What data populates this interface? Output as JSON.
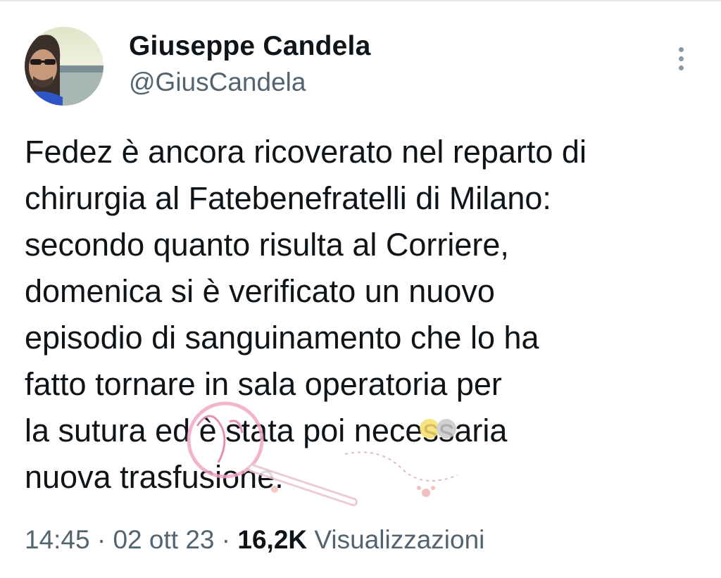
{
  "author": {
    "name": "Giuseppe Candela",
    "handle": "@GiusCandela"
  },
  "tweet": {
    "lines": [
      "Fedez è ancora ricoverato nel reparto di",
      "chirurgia al Fatebenefratelli di Milano:",
      "secondo quanto risulta al Corriere,",
      "domenica si è verificato un nuovo",
      "episodio di sanguinamento che lo ha",
      "fatto tornare in sala operatoria per",
      "la sutura ed è stata poi necessaria",
      "nuova trasfusione."
    ]
  },
  "meta": {
    "time": "14:45",
    "separator": "·",
    "date": "02 ott 23",
    "views_count": "16,2K",
    "views_label": "Visualizzazioni"
  },
  "icons": {
    "more": "vertical-ellipsis-icon"
  },
  "colors": {
    "text_primary": "#0f1419",
    "text_secondary": "#536471",
    "icon_gray": "#8b98a5"
  }
}
